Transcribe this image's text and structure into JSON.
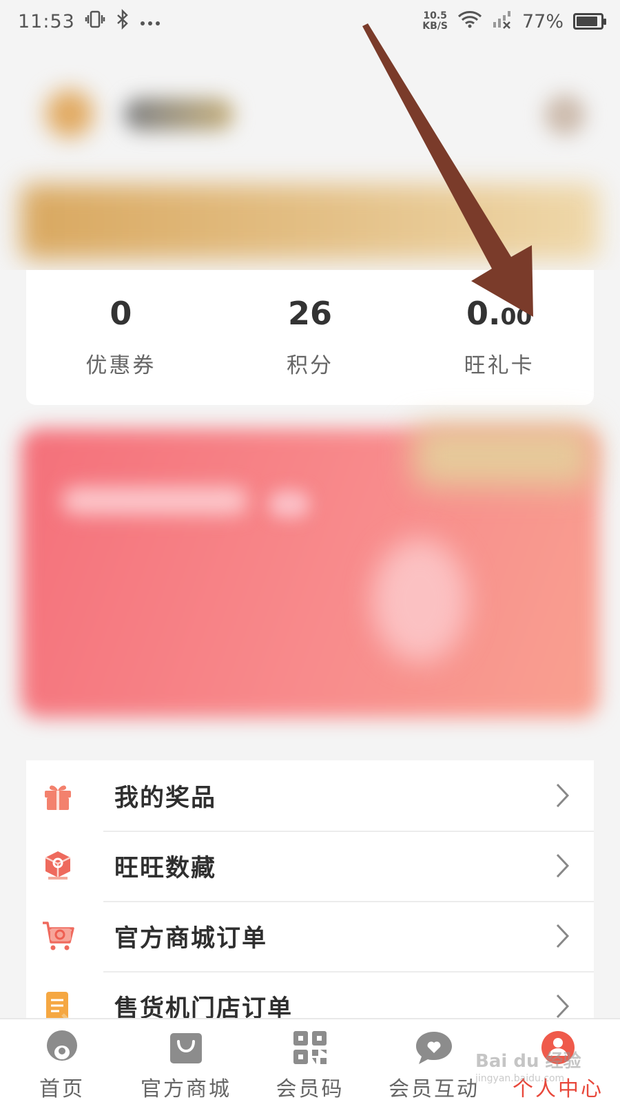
{
  "status_bar": {
    "time": "11:53",
    "network_speed_value": "10.5",
    "network_speed_unit": "KB/S",
    "battery": "77%",
    "icons": [
      "vibrate-icon",
      "bluetooth-icon",
      "more-dots-icon",
      "wifi-icon",
      "signal-icon",
      "battery-icon"
    ]
  },
  "stats": {
    "items": [
      {
        "value": "0",
        "label": "优惠券"
      },
      {
        "value": "26",
        "label": "积分"
      },
      {
        "value_main": "0.",
        "value_decimal": "00",
        "label": "旺礼卡"
      }
    ]
  },
  "menu": {
    "items": [
      {
        "label": "我的奖品",
        "icon": "gift-icon"
      },
      {
        "label": "旺旺数藏",
        "icon": "collection-cube-icon"
      },
      {
        "label": "官方商城订单",
        "icon": "mall-cart-icon"
      },
      {
        "label": "售货机门店订单",
        "icon": "order-document-icon"
      }
    ]
  },
  "tabs": {
    "items": [
      {
        "label": "首页",
        "icon": "home-icon"
      },
      {
        "label": "官方商城",
        "icon": "shopping-bag-icon"
      },
      {
        "label": "会员码",
        "icon": "qr-code-icon"
      },
      {
        "label": "会员互动",
        "icon": "chat-heart-icon"
      },
      {
        "label": "个人中心",
        "icon": "profile-icon",
        "active": true
      }
    ]
  },
  "watermark": {
    "text": "Bai du 经验",
    "subtext": "jingyan.baidu.com"
  },
  "colors": {
    "accent_red": "#e8483b",
    "menu_icon_red": "#f07262",
    "menu_icon_orange": "#f5a742",
    "annotation_arrow": "#7a3b2a"
  }
}
